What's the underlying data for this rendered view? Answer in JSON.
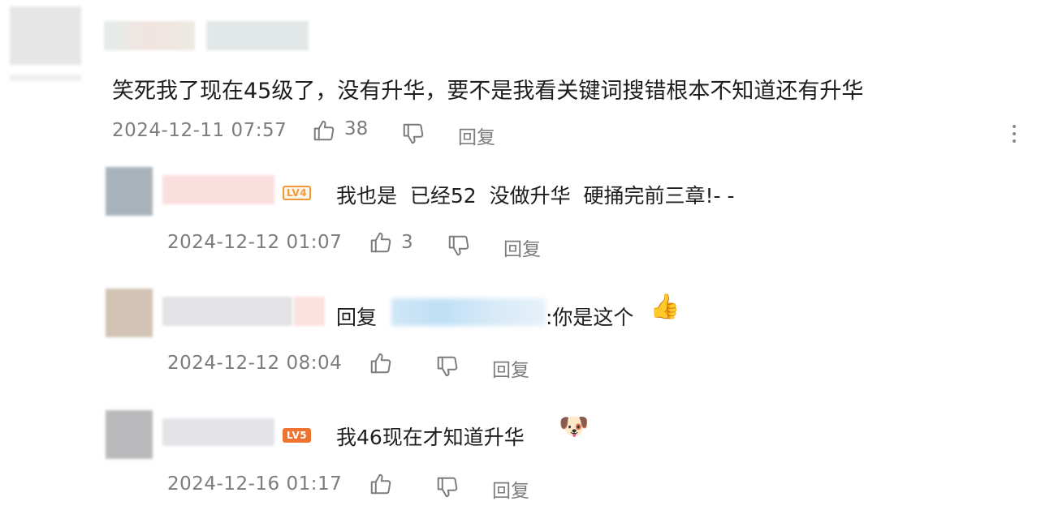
{
  "main_comment": {
    "text": "笑死我了现在45级了，没有升华，要不是我看关键词搜错根本不知道还有升华",
    "time": "2024-12-11 07:57",
    "likes": "38",
    "reply_label": "回复"
  },
  "replies": [
    {
      "badge": "LV4",
      "text": "我也是  已经52  没做升华  硬捅完前三章!- -",
      "time": "2024-12-12 01:07",
      "likes": "3",
      "reply_label": "回复"
    },
    {
      "prefix": "回复",
      "text": ":你是这个",
      "emoji": "👍",
      "time": "2024-12-12 08:04",
      "reply_label": "回复"
    },
    {
      "badge": "LV5",
      "text": "我46现在才知道升华",
      "emoji": "🐶",
      "time": "2024-12-16 01:17",
      "reply_label": "回复"
    }
  ],
  "icons": {
    "like": "thumbs-up-icon",
    "dislike": "thumbs-down-icon",
    "more": "more-vertical-icon"
  },
  "colors": {
    "meta_text": "#7c7c7c",
    "badge_orange": "#f09a37"
  }
}
